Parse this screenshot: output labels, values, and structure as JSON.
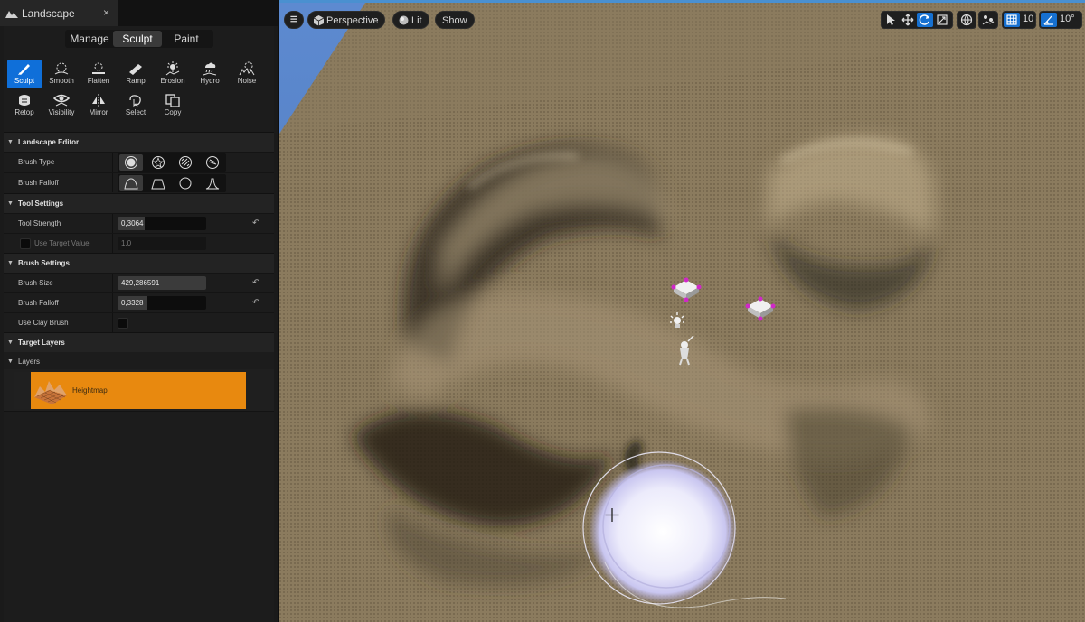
{
  "panel": {
    "tab_title": "Landscape",
    "close_glyph": "×",
    "modes": [
      "Manage",
      "Sculpt",
      "Paint"
    ],
    "active_mode": "Sculpt",
    "tools": [
      {
        "label": "Sculpt",
        "icon": "sculpt-brush-icon"
      },
      {
        "label": "Smooth",
        "icon": "smooth-icon"
      },
      {
        "label": "Flatten",
        "icon": "flatten-icon"
      },
      {
        "label": "Ramp",
        "icon": "ramp-icon"
      },
      {
        "label": "Erosion",
        "icon": "erosion-icon"
      },
      {
        "label": "Hydro",
        "icon": "hydro-icon"
      },
      {
        "label": "Noise",
        "icon": "noise-icon"
      },
      {
        "label": "Retop",
        "icon": "retopologize-icon"
      },
      {
        "label": "Visibility",
        "icon": "visibility-icon"
      },
      {
        "label": "Mirror",
        "icon": "mirror-icon"
      },
      {
        "label": "Select",
        "icon": "select-icon"
      },
      {
        "label": "Copy",
        "icon": "copy-icon"
      }
    ],
    "active_tool": "Sculpt",
    "landscape_editor": {
      "title": "Landscape Editor",
      "brush_type_label": "Brush Type",
      "brush_falloff_label": "Brush Falloff"
    },
    "tool_settings": {
      "title": "Tool Settings",
      "tool_strength_label": "Tool Strength",
      "tool_strength_value": "0,3064",
      "tool_strength_fraction": 0.3064,
      "use_target_value_label": "Use Target Value",
      "use_target_value": "1,0"
    },
    "brush_settings": {
      "title": "Brush Settings",
      "brush_size_label": "Brush Size",
      "brush_size_value": "429,286591",
      "brush_falloff_label": "Brush Falloff",
      "brush_falloff_value": "0,3328",
      "brush_falloff_fraction": 0.3328,
      "clay_brush_label": "Use Clay Brush"
    },
    "target_layers": {
      "title": "Target Layers",
      "layers_label": "Layers",
      "layer_name": "Heightmap"
    }
  },
  "viewport": {
    "perspective_label": "Perspective",
    "lit_label": "Lit",
    "show_label": "Show",
    "grid_snap_value": "10",
    "rotation_snap_value": "10°",
    "colors": {
      "sky": "#4f7fc7",
      "ground": "#8b7b5e",
      "accent": "#1670d0",
      "layer_orange": "#e8890f"
    }
  }
}
